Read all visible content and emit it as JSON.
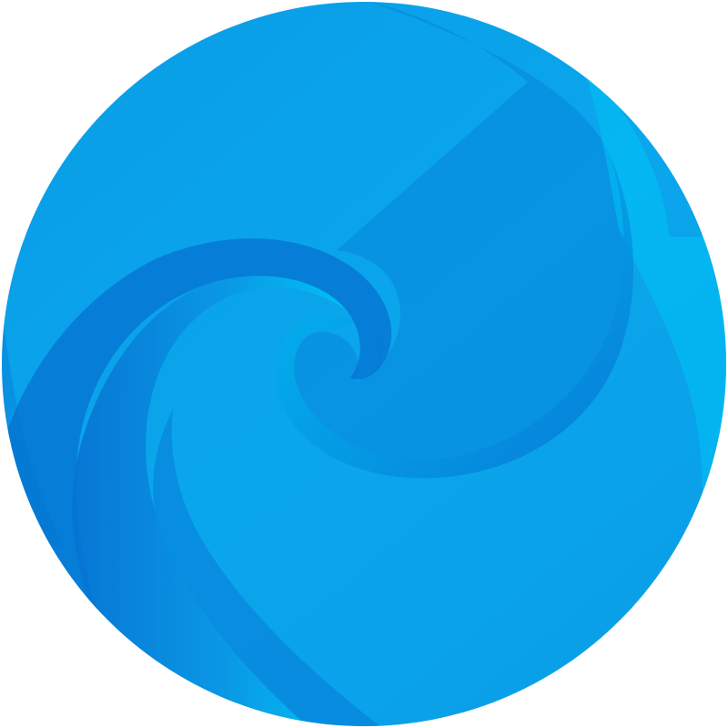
{
  "logo": {
    "icon": "blue-swirl-icon",
    "shape": "circle",
    "colors": {
      "background": "#ffffff",
      "light": "#00c3f5",
      "mid": "#0a9fe8",
      "dark": "#0672d2"
    }
  }
}
